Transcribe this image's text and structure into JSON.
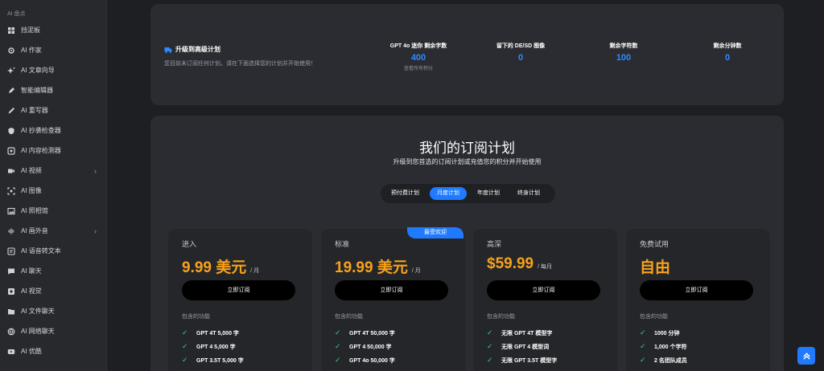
{
  "sidebar": {
    "header": "AI 盘点",
    "items": [
      {
        "label": "挡泥板",
        "icon": "dashboard-icon",
        "has_chevron": false
      },
      {
        "label": "AI 作家",
        "icon": "gear-icon",
        "has_chevron": false
      },
      {
        "label": "AI 文章向导",
        "icon": "sparkle-icon",
        "has_chevron": false
      },
      {
        "label": "智能编辑器",
        "icon": "pen-nib-icon",
        "has_chevron": false
      },
      {
        "label": "AI 重写器",
        "icon": "pencil-icon",
        "has_chevron": false
      },
      {
        "label": "AI 抄袭检查器",
        "icon": "shield-icon",
        "has_chevron": false
      },
      {
        "label": "AI 内容检测器",
        "icon": "detector-icon",
        "has_chevron": false
      },
      {
        "label": "AI 视频",
        "icon": "video-icon",
        "has_chevron": true
      },
      {
        "label": "AI 图像",
        "icon": "image-scan-icon",
        "has_chevron": false
      },
      {
        "label": "AI 照相馆",
        "icon": "photo-icon",
        "has_chevron": false
      },
      {
        "label": "AI 画外音",
        "icon": "audio-wave-icon",
        "has_chevron": true
      },
      {
        "label": "AI 语音转文本",
        "icon": "speech-text-icon",
        "has_chevron": false
      },
      {
        "label": "AI 聊天",
        "icon": "chat-icon",
        "has_chevron": false
      },
      {
        "label": "AI 视觉",
        "icon": "eye-icon",
        "has_chevron": false
      },
      {
        "label": "AI 文件聊天",
        "icon": "folder-chat-icon",
        "has_chevron": false
      },
      {
        "label": "AI 网络聊天",
        "icon": "globe-icon",
        "has_chevron": false
      },
      {
        "label": "AI 优酷",
        "icon": "youtube-icon",
        "has_chevron": false
      }
    ]
  },
  "top_card": {
    "title": "升级到高级计划",
    "subtitle": "您目前未订阅任何计划。请在下面选择您的计划并开始使用！",
    "stats": [
      {
        "label": "GPT 4o 迷你 剩余字数",
        "value": "400",
        "note": "查看所有积分"
      },
      {
        "label": "留下的 DE/SD 图像",
        "value": "0",
        "note": ""
      },
      {
        "label": "剩余字符数",
        "value": "100",
        "note": ""
      },
      {
        "label": "剩余分钟数",
        "value": "0",
        "note": ""
      }
    ]
  },
  "plans_section": {
    "title": "我们的订阅计划",
    "subtitle": "升级到您首选的订阅计划或充值您的积分并开始使用",
    "tabs": [
      {
        "label": "预付费计划",
        "active": false
      },
      {
        "label": "月度计划",
        "active": true
      },
      {
        "label": "年度计划",
        "active": false
      },
      {
        "label": "终身计划",
        "active": false
      }
    ],
    "plans": [
      {
        "name": "进入",
        "price": "9.99 美元",
        "period": "/ 月",
        "badge": "",
        "button": "立即订阅",
        "features_title": "包含的功能",
        "features": [
          "GPT 4T 5,000 字",
          "GPT 4 5,000 字",
          "GPT 3.5T 5,000 字"
        ]
      },
      {
        "name": "标准",
        "price": "19.99 美元",
        "period": "/ 月",
        "badge": "最受欢迎",
        "button": "立即订阅",
        "features_title": "包含的功能",
        "features": [
          "GPT 4T 50,000 字",
          "GPT 4 50,000 字",
          "GPT 4o 50,000 字"
        ]
      },
      {
        "name": "高深",
        "price": "$59.99",
        "period": "/ 每月",
        "badge": "",
        "button": "立即订阅",
        "features_title": "包含的功能",
        "features": [
          "无限 GPT 4T 模型字",
          "无限 GPT 4 模型词",
          "无限 GPT 3.5T 模型字"
        ]
      },
      {
        "name": "免费试用",
        "price": "自由",
        "period": "",
        "badge": "",
        "button": "立即订阅",
        "features_title": "包含的功能",
        "features": [
          "1000 分钟",
          "1,000 个字符",
          "2 名团队成员"
        ]
      }
    ]
  },
  "colors": {
    "accent": "#1f7aff",
    "price": "#f7a21b",
    "check": "#3ccf7d",
    "background": "#1e1f22",
    "card": "#2b2c31"
  }
}
